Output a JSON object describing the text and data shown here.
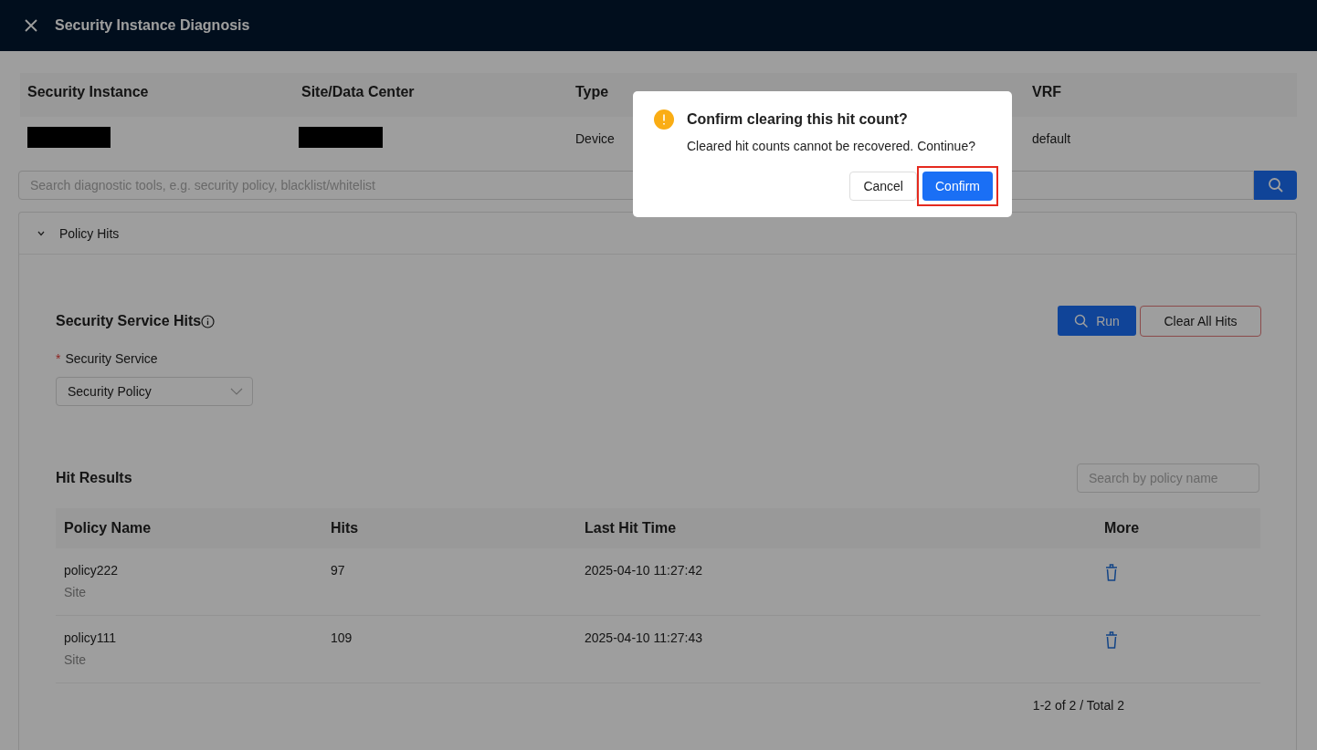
{
  "window": {
    "title": "Security Instance Diagnosis"
  },
  "instance_table": {
    "columns": [
      {
        "kind": "text",
        "text": "Security Instance"
      },
      {
        "kind": "text",
        "text": "Site/Data Center"
      },
      {
        "kind": "text",
        "text": "Type"
      },
      {
        "kind": "blank"
      },
      {
        "kind": "text",
        "text": "VRF"
      }
    ],
    "row": [
      {
        "kind": "redacted"
      },
      {
        "kind": "redacted"
      },
      {
        "kind": "text",
        "text": "Device"
      },
      {
        "kind": "blank"
      },
      {
        "kind": "text",
        "text": "default"
      }
    ]
  },
  "tool_search": {
    "placeholder": "Search diagnostic tools, e.g. security policy, blacklist/whitelist"
  },
  "panel": {
    "title": "Policy Hits",
    "expanded": true
  },
  "section": {
    "title": "Security Service Hits",
    "run_button": "Run",
    "clear_button": "Clear All Hits"
  },
  "service_field": {
    "label": "Security Service",
    "required": true,
    "required_mark": "*",
    "value": "Security Policy"
  },
  "results": {
    "title": "Hit Results",
    "search_placeholder": "Search by policy name",
    "columns": [
      "Policy Name",
      "Hits",
      "Last Hit Time",
      "More"
    ],
    "rows": [
      {
        "name": "policy222",
        "scope": "Site",
        "hits": "97",
        "time": "2025-04-10 11:27:42"
      },
      {
        "name": "policy111",
        "scope": "Site",
        "hits": "109",
        "time": "2025-04-10 11:27:43"
      }
    ],
    "pagination": "1-2 of 2 / Total 2"
  },
  "dialog": {
    "title": "Confirm clearing this hit count?",
    "message": "Cleared hit counts cannot be recovered. Continue?",
    "buttons": [
      {
        "label": "Cancel",
        "kind": "default",
        "highlighted": false
      },
      {
        "label": "Confirm",
        "kind": "primary",
        "highlighted": true
      }
    ]
  }
}
